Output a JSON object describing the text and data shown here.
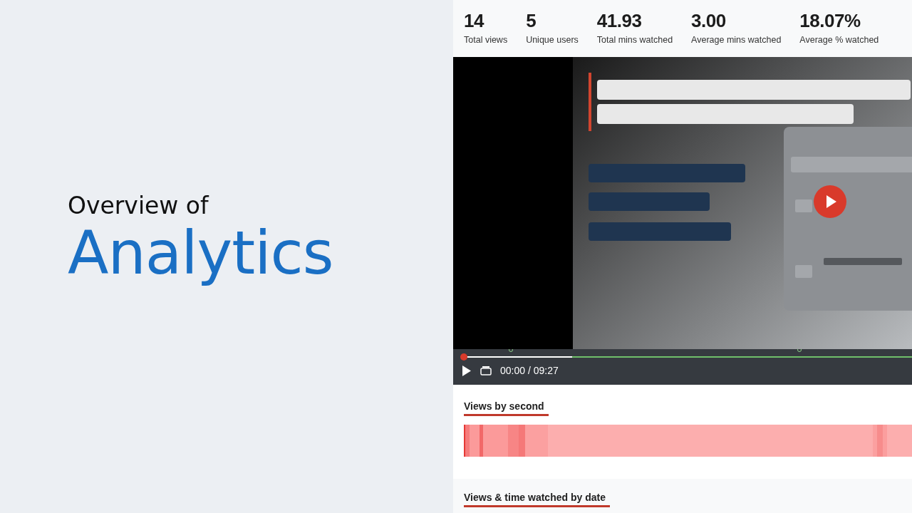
{
  "slide": {
    "kicker": "Overview of",
    "title": "Analytics"
  },
  "stats": [
    {
      "value": "14",
      "label": "Total views"
    },
    {
      "value": "5",
      "label": "Unique users"
    },
    {
      "value": "41.93",
      "label": "Total mins watched"
    },
    {
      "value": "3.00",
      "label": "Average mins watched"
    },
    {
      "value": "18.07%",
      "label": "Average % watched"
    }
  ],
  "video": {
    "kind": "picture",
    "time": "00:00 / 09:27",
    "level": 0
  },
  "sections": [
    {
      "title": "Views by second",
      "kind": "heatmap"
    },
    {
      "title": "Views & time watched by date",
      "kind": "plain"
    }
  ]
}
